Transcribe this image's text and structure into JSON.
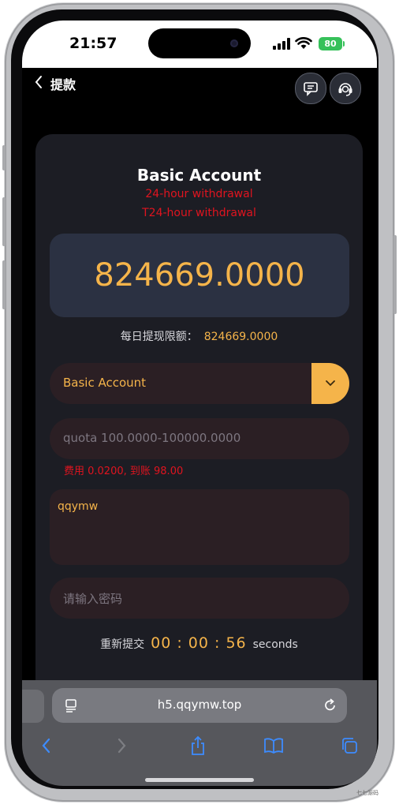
{
  "status_bar": {
    "time": "21:57",
    "battery": "80"
  },
  "header": {
    "title": "提款",
    "icons": [
      "back-chevron-icon",
      "message-icon",
      "customer-service-icon"
    ]
  },
  "account": {
    "title": "Basic Account",
    "note_1": "24-hour withdrawal",
    "note_2": "T24-hour withdrawal",
    "balance": "824669.0000",
    "daily_limit_label": "每日提现限额：",
    "daily_limit_value": "824669.0000"
  },
  "form": {
    "account_select": "Basic Account",
    "amount_placeholder": "quota 100.0000-100000.0000",
    "fee_text": "费用 0.0200, 到账 98.00",
    "remark_value": "qqymw",
    "password_placeholder": "请输入密码",
    "resubmit_label": "重新提交",
    "countdown": "00 : 00 : 56",
    "countdown_unit": "seconds"
  },
  "browser": {
    "url": "h5.qqymw.top",
    "toolbar_icons": [
      "back-icon",
      "forward-icon",
      "share-icon",
      "bookmarks-icon",
      "tabs-icon"
    ]
  },
  "watermark": "七七源码",
  "colors": {
    "accent": "#f5b44a",
    "warning": "#e0141f",
    "card": "#1c1d24",
    "field": "#2b1f24"
  }
}
